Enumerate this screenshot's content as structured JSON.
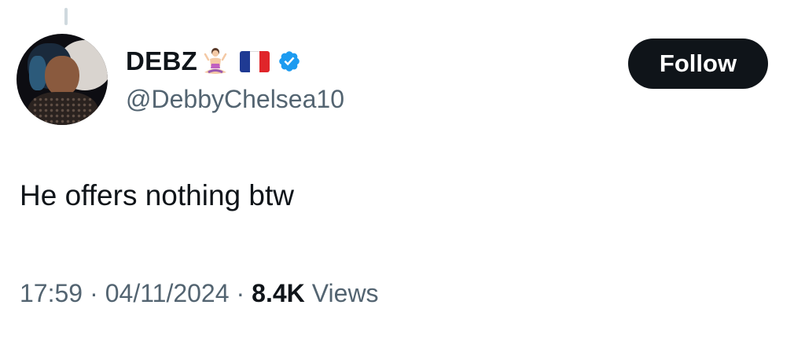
{
  "tweet": {
    "author": {
      "display_name": "DEBZ",
      "handle": "@DebbyChelsea10",
      "emojis": [
        "woman-in-lotus-position-icon",
        "france-flag-icon"
      ],
      "verified": true
    },
    "follow_label": "Follow",
    "text": "He offers nothing btw",
    "time": "17:59",
    "date": "04/11/2024",
    "separator": "·",
    "views_count": "8.4K",
    "views_label": "Views"
  },
  "colors": {
    "primary_text": "#0f1419",
    "secondary_text": "#536471",
    "verified_blue": "#1d9bf0",
    "follow_bg": "#0f1419"
  }
}
